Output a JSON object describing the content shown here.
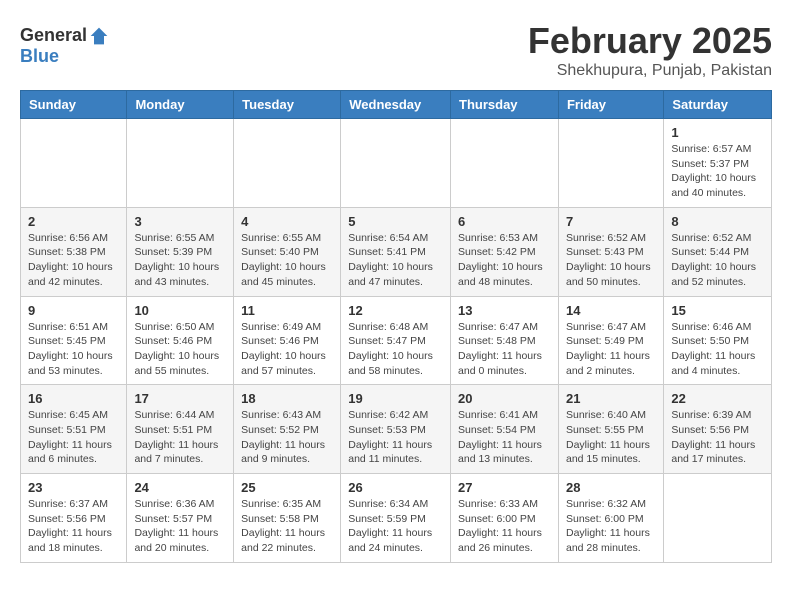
{
  "header": {
    "logo_general": "General",
    "logo_blue": "Blue",
    "month": "February 2025",
    "location": "Shekhupura, Punjab, Pakistan"
  },
  "weekdays": [
    "Sunday",
    "Monday",
    "Tuesday",
    "Wednesday",
    "Thursday",
    "Friday",
    "Saturday"
  ],
  "weeks": [
    [
      {
        "day": "",
        "info": ""
      },
      {
        "day": "",
        "info": ""
      },
      {
        "day": "",
        "info": ""
      },
      {
        "day": "",
        "info": ""
      },
      {
        "day": "",
        "info": ""
      },
      {
        "day": "",
        "info": ""
      },
      {
        "day": "1",
        "info": "Sunrise: 6:57 AM\nSunset: 5:37 PM\nDaylight: 10 hours\nand 40 minutes."
      }
    ],
    [
      {
        "day": "2",
        "info": "Sunrise: 6:56 AM\nSunset: 5:38 PM\nDaylight: 10 hours\nand 42 minutes."
      },
      {
        "day": "3",
        "info": "Sunrise: 6:55 AM\nSunset: 5:39 PM\nDaylight: 10 hours\nand 43 minutes."
      },
      {
        "day": "4",
        "info": "Sunrise: 6:55 AM\nSunset: 5:40 PM\nDaylight: 10 hours\nand 45 minutes."
      },
      {
        "day": "5",
        "info": "Sunrise: 6:54 AM\nSunset: 5:41 PM\nDaylight: 10 hours\nand 47 minutes."
      },
      {
        "day": "6",
        "info": "Sunrise: 6:53 AM\nSunset: 5:42 PM\nDaylight: 10 hours\nand 48 minutes."
      },
      {
        "day": "7",
        "info": "Sunrise: 6:52 AM\nSunset: 5:43 PM\nDaylight: 10 hours\nand 50 minutes."
      },
      {
        "day": "8",
        "info": "Sunrise: 6:52 AM\nSunset: 5:44 PM\nDaylight: 10 hours\nand 52 minutes."
      }
    ],
    [
      {
        "day": "9",
        "info": "Sunrise: 6:51 AM\nSunset: 5:45 PM\nDaylight: 10 hours\nand 53 minutes."
      },
      {
        "day": "10",
        "info": "Sunrise: 6:50 AM\nSunset: 5:46 PM\nDaylight: 10 hours\nand 55 minutes."
      },
      {
        "day": "11",
        "info": "Sunrise: 6:49 AM\nSunset: 5:46 PM\nDaylight: 10 hours\nand 57 minutes."
      },
      {
        "day": "12",
        "info": "Sunrise: 6:48 AM\nSunset: 5:47 PM\nDaylight: 10 hours\nand 58 minutes."
      },
      {
        "day": "13",
        "info": "Sunrise: 6:47 AM\nSunset: 5:48 PM\nDaylight: 11 hours\nand 0 minutes."
      },
      {
        "day": "14",
        "info": "Sunrise: 6:47 AM\nSunset: 5:49 PM\nDaylight: 11 hours\nand 2 minutes."
      },
      {
        "day": "15",
        "info": "Sunrise: 6:46 AM\nSunset: 5:50 PM\nDaylight: 11 hours\nand 4 minutes."
      }
    ],
    [
      {
        "day": "16",
        "info": "Sunrise: 6:45 AM\nSunset: 5:51 PM\nDaylight: 11 hours\nand 6 minutes."
      },
      {
        "day": "17",
        "info": "Sunrise: 6:44 AM\nSunset: 5:51 PM\nDaylight: 11 hours\nand 7 minutes."
      },
      {
        "day": "18",
        "info": "Sunrise: 6:43 AM\nSunset: 5:52 PM\nDaylight: 11 hours\nand 9 minutes."
      },
      {
        "day": "19",
        "info": "Sunrise: 6:42 AM\nSunset: 5:53 PM\nDaylight: 11 hours\nand 11 minutes."
      },
      {
        "day": "20",
        "info": "Sunrise: 6:41 AM\nSunset: 5:54 PM\nDaylight: 11 hours\nand 13 minutes."
      },
      {
        "day": "21",
        "info": "Sunrise: 6:40 AM\nSunset: 5:55 PM\nDaylight: 11 hours\nand 15 minutes."
      },
      {
        "day": "22",
        "info": "Sunrise: 6:39 AM\nSunset: 5:56 PM\nDaylight: 11 hours\nand 17 minutes."
      }
    ],
    [
      {
        "day": "23",
        "info": "Sunrise: 6:37 AM\nSunset: 5:56 PM\nDaylight: 11 hours\nand 18 minutes."
      },
      {
        "day": "24",
        "info": "Sunrise: 6:36 AM\nSunset: 5:57 PM\nDaylight: 11 hours\nand 20 minutes."
      },
      {
        "day": "25",
        "info": "Sunrise: 6:35 AM\nSunset: 5:58 PM\nDaylight: 11 hours\nand 22 minutes."
      },
      {
        "day": "26",
        "info": "Sunrise: 6:34 AM\nSunset: 5:59 PM\nDaylight: 11 hours\nand 24 minutes."
      },
      {
        "day": "27",
        "info": "Sunrise: 6:33 AM\nSunset: 6:00 PM\nDaylight: 11 hours\nand 26 minutes."
      },
      {
        "day": "28",
        "info": "Sunrise: 6:32 AM\nSunset: 6:00 PM\nDaylight: 11 hours\nand 28 minutes."
      },
      {
        "day": "",
        "info": ""
      }
    ]
  ]
}
